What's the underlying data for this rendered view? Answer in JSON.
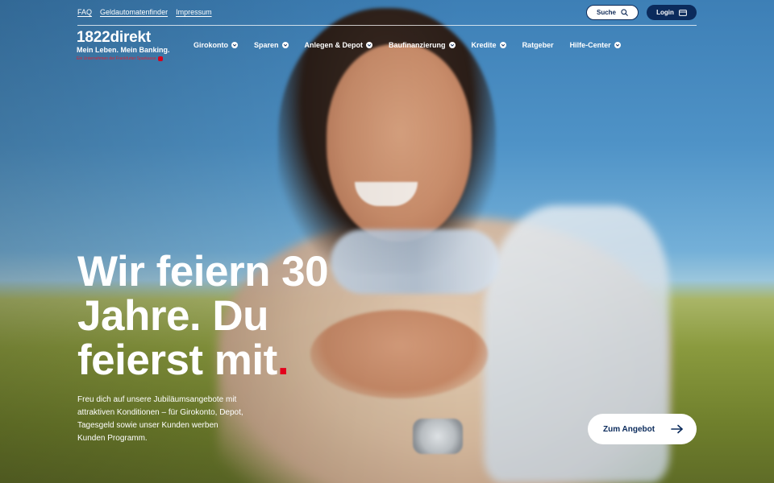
{
  "utility_links": [
    "FAQ",
    "Geldautomatenfinder",
    "Impressum"
  ],
  "actions": {
    "search_label": "Suche",
    "login_label": "Login"
  },
  "logo": {
    "mark": "1822direkt",
    "tagline": "Mein Leben. Mein Banking.",
    "subline": "Ein Unternehmen der Frankfurter Sparkasse"
  },
  "nav": [
    {
      "label": "Girokonto",
      "has_dropdown": true
    },
    {
      "label": "Sparen",
      "has_dropdown": true
    },
    {
      "label": "Anlegen & Depot",
      "has_dropdown": true
    },
    {
      "label": "Baufinanzierung",
      "has_dropdown": true
    },
    {
      "label": "Kredite",
      "has_dropdown": true
    },
    {
      "label": "Ratgeber",
      "has_dropdown": false
    },
    {
      "label": "Hilfe-Center",
      "has_dropdown": true
    }
  ],
  "hero": {
    "headline": "Wir feiern 30 Jahre. Du feierst mit",
    "headline_dot": ".",
    "subcopy": "Freu dich auf unsere Jubiläumsangebote mit attraktiven Konditionen – für Girokonto, Depot, Tagesgeld sowie unser Kunden werben Kunden Programm.",
    "cta_label": "Zum Angebot"
  },
  "colors": {
    "brand_navy": "#0b2b5c",
    "accent_red": "#e3001b"
  },
  "icons": {
    "search": "search-icon",
    "login": "card-icon",
    "dropdown": "chevron-down-icon",
    "cta": "arrow-right-icon"
  }
}
